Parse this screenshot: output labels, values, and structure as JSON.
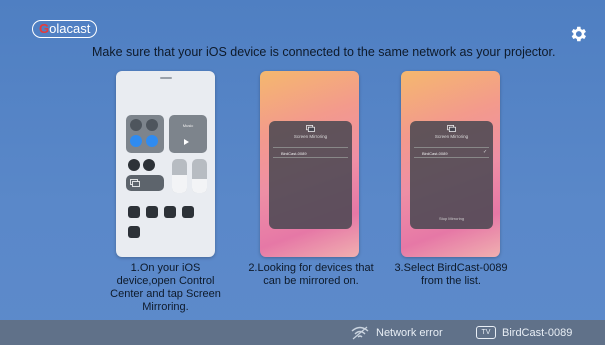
{
  "app": {
    "logo_text": "olacast",
    "logo_initial": "G"
  },
  "header": {
    "instruction": "Make sure that your iOS device is connected to the same network as your projector."
  },
  "steps": [
    {
      "caption": "1.On your iOS device,open Control Center and tap Screen Mirroring."
    },
    {
      "caption": "2.Looking for devices that can be mirrored on.",
      "screen_title": "Screen Mirroring",
      "device": "BirdCast-0089"
    },
    {
      "caption": "3.Select BirdCast-0089 from the list.",
      "screen_title": "Screen Mirroring",
      "device": "BirdCast-0089",
      "stop_label": "Stop Mirroring"
    }
  ],
  "control_center": {
    "music_label": "Music"
  },
  "status": {
    "network_text": "Network error",
    "device_text": "BirdCast-0089",
    "tv_label": "TV"
  },
  "colors": {
    "background": "#5a88c9",
    "statusbar": "#607189",
    "logo_accent": "#e63a3a"
  },
  "icons": [
    "gear-icon",
    "wifi-icon",
    "tv-icon",
    "screen-mirror-icon"
  ]
}
